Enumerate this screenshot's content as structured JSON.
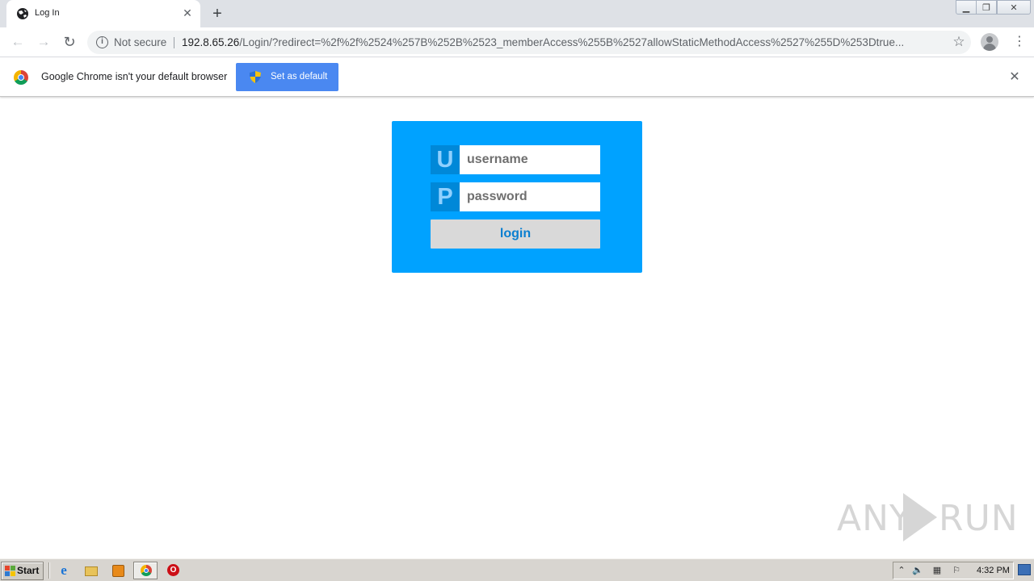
{
  "browser": {
    "tab": {
      "title": "Log In"
    },
    "new_tab_label": "+",
    "address": {
      "security_label": "Not secure",
      "host": "192.8.65.26",
      "path": "/Login/?redirect=%2f%2f%2524%257B%252B%2523_memberAccess%255B%2527allowStaticMethodAccess%2527%255D%253Dtrue..."
    },
    "infobar": {
      "message": "Google Chrome isn't your default browser",
      "button_label": "Set as default"
    }
  },
  "login_form": {
    "username_icon": "U",
    "username_placeholder": "username",
    "password_icon": "P",
    "password_placeholder": "password",
    "submit_label": "login",
    "accent_color": "#00a2ff"
  },
  "watermark": {
    "left": "ANY",
    "right": "RUN"
  },
  "taskbar": {
    "start_label": "Start",
    "clock": "4:32 PM"
  }
}
